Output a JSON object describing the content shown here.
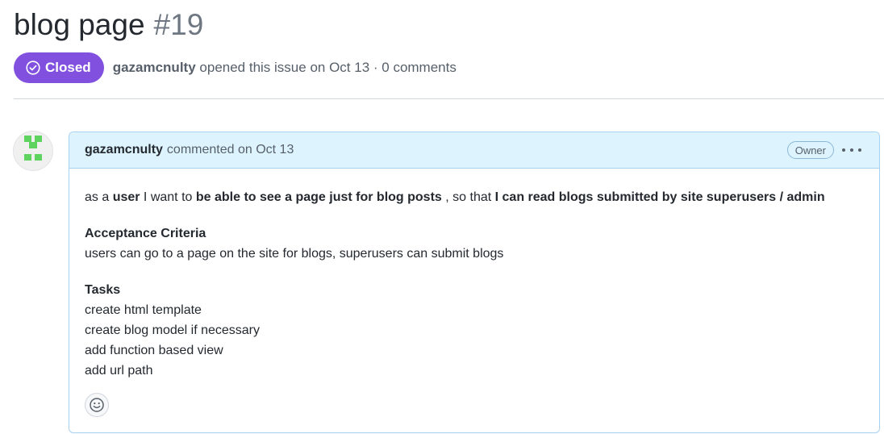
{
  "issue": {
    "title": "blog page",
    "number": "#19",
    "state": "Closed",
    "author": "gazamcnulty",
    "opened_text": "opened this issue on Oct 13 · 0 comments"
  },
  "comment": {
    "author": "gazamcnulty",
    "commented_text": "commented on Oct 13",
    "owner_badge": "Owner",
    "story": {
      "p1": "as a ",
      "b1": "user",
      "p2": " I want to ",
      "b2": "be able to see a page just for blog posts",
      "p3": " , so that ",
      "b3": "I can read blogs submitted by site superusers / admin"
    },
    "acceptance_heading": "Acceptance Criteria",
    "acceptance_text": "users can go to a page on the site for blogs, superusers can submit blogs",
    "tasks_heading": "Tasks",
    "tasks": [
      "create html template",
      "create blog model if necessary",
      "add function based view",
      "add url path"
    ]
  },
  "icons": {
    "state": "check-circle-icon",
    "more": "kebab-horizontal-icon",
    "reaction": "smiley-icon",
    "avatar": "identicon"
  },
  "colors": {
    "closed_badge": "#8250df",
    "comment_header_bg": "#ddf4ff",
    "comment_border": "#a9d2f0",
    "identicon": "#5fd35f"
  }
}
